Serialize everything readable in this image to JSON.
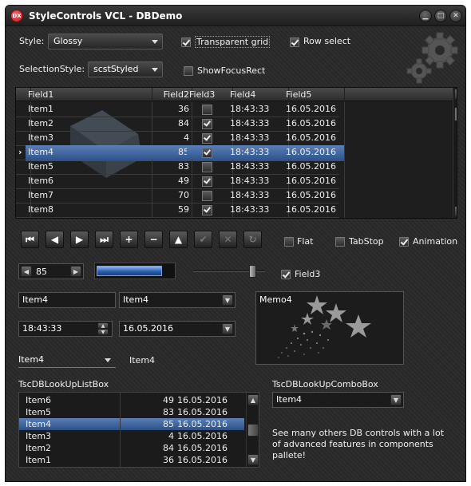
{
  "window": {
    "title": "StyleControls VCL - DBDemo",
    "logo": "DX"
  },
  "colors": {
    "accent": "#3d6aa8",
    "window_bg": "#2a2a2a"
  },
  "options": {
    "style_label": "Style:",
    "style_value": "Glossy",
    "transparent_grid_label": "Transparent grid",
    "transparent_grid_checked": true,
    "row_select_label": "Row select",
    "row_select_checked": true,
    "selection_style_label": "SelectionStyle:",
    "selection_style_value": "scstStyled",
    "show_focus_rect_label": "ShowFocusRect",
    "show_focus_rect_checked": false
  },
  "grid": {
    "columns": [
      "Field1",
      "Field2",
      "Field3",
      "Field4",
      "Field5"
    ],
    "rows": [
      {
        "f1": "Item1",
        "f2": "36",
        "f3": false,
        "f4": "18:43:33",
        "f5": "16.05.2016"
      },
      {
        "f1": "Item2",
        "f2": "84",
        "f3": true,
        "f4": "18:43:33",
        "f5": "16.05.2016"
      },
      {
        "f1": "Item3",
        "f2": "4",
        "f3": true,
        "f4": "18:43:33",
        "f5": "16.05.2016"
      },
      {
        "f1": "Item4",
        "f2": "85",
        "f3": true,
        "f4": "18:43:33",
        "f5": "16.05.2016",
        "selected": true
      },
      {
        "f1": "Item5",
        "f2": "83",
        "f3": false,
        "f4": "18:43:33",
        "f5": "16.05.2016"
      },
      {
        "f1": "Item6",
        "f2": "49",
        "f3": true,
        "f4": "18:43:33",
        "f5": "16.05.2016"
      },
      {
        "f1": "Item7",
        "f2": "70",
        "f3": false,
        "f4": "18:43:33",
        "f5": "16.05.2016"
      },
      {
        "f1": "Item8",
        "f2": "59",
        "f3": true,
        "f4": "18:43:33",
        "f5": "16.05.2016"
      }
    ]
  },
  "navigator": {
    "buttons": [
      {
        "name": "first",
        "glyph": "⏮",
        "enabled": true
      },
      {
        "name": "prior",
        "glyph": "◀",
        "enabled": true
      },
      {
        "name": "next",
        "glyph": "▶",
        "enabled": true
      },
      {
        "name": "last",
        "glyph": "⏭",
        "enabled": true
      },
      {
        "name": "insert",
        "glyph": "+",
        "enabled": true
      },
      {
        "name": "delete",
        "glyph": "−",
        "enabled": true
      },
      {
        "name": "edit",
        "glyph": "▲",
        "enabled": true
      },
      {
        "name": "post",
        "glyph": "✔",
        "enabled": false
      },
      {
        "name": "cancel",
        "glyph": "✕",
        "enabled": false
      },
      {
        "name": "refresh",
        "glyph": "↻",
        "enabled": false
      }
    ],
    "flat_label": "Flat",
    "flat_checked": false,
    "tabstop_label": "TabStop",
    "tabstop_checked": false,
    "animation_label": "Animation",
    "animation_checked": true
  },
  "controls": {
    "spin_value": "85",
    "progress_fraction": 0.85,
    "slider_fraction": 0.85,
    "field3_label": "Field3",
    "field3_checked": true,
    "edit_value": "Item4",
    "combo_value": "Item4",
    "time_value": "18:43:33",
    "date_value": "16.05.2016",
    "lookup_combo_small": "Item4",
    "label_value": "Item4",
    "memo_text": "Memo4"
  },
  "lookup_listbox": {
    "label": "TscDBLookUpListBox",
    "rows": [
      {
        "name": "Item6",
        "value": "49",
        "date": "16.05.2016"
      },
      {
        "name": "Item5",
        "value": "83",
        "date": "16.05.2016"
      },
      {
        "name": "Item4",
        "value": "85",
        "date": "16.05.2016",
        "selected": true
      },
      {
        "name": "Item3",
        "value": "4",
        "date": "16.05.2016"
      },
      {
        "name": "Item2",
        "value": "84",
        "date": "16.05.2016"
      },
      {
        "name": "Item1",
        "value": "36",
        "date": "16.05.2016"
      }
    ]
  },
  "lookup_combobox": {
    "label": "TscDBLookUpComboBox",
    "value": "Item4"
  },
  "info_text": "See many others DB controls with a lot of advanced features in components pallete!"
}
